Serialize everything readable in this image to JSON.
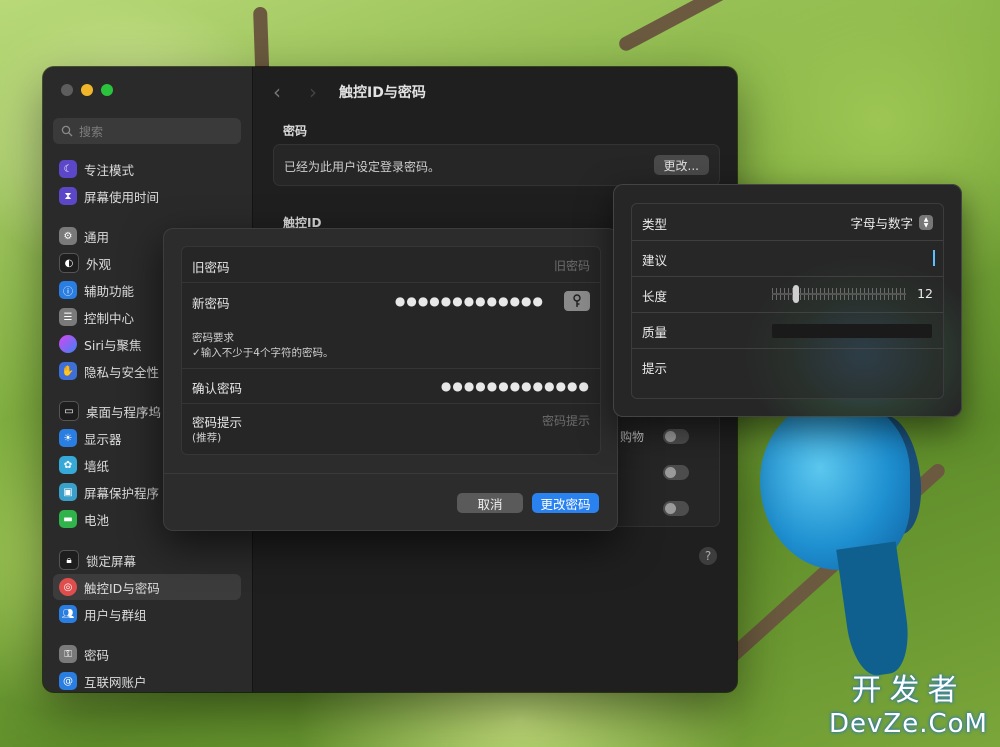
{
  "window": {
    "title": "触控ID与密码",
    "search_placeholder": "搜索"
  },
  "sidebar": {
    "items": [
      {
        "label": "专注模式",
        "icon": "moon-icon",
        "color": "#5d47c9"
      },
      {
        "label": "屏幕使用时间",
        "icon": "hourglass-icon",
        "color": "#5d47c9"
      },
      {
        "label": "通用",
        "icon": "gear-icon",
        "color": "#7a7a7a"
      },
      {
        "label": "外观",
        "icon": "appearance-icon",
        "color": "#1e1e1e"
      },
      {
        "label": "辅助功能",
        "icon": "accessibility-icon",
        "color": "#2a7de1"
      },
      {
        "label": "控制中心",
        "icon": "control-center-icon",
        "color": "#7a7a7a"
      },
      {
        "label": "Siri与聚焦",
        "icon": "siri-icon",
        "color": "#8a3fd8"
      },
      {
        "label": "隐私与安全性",
        "icon": "hand-icon",
        "color": "#3d6fd6"
      },
      {
        "label": "桌面与程序坞",
        "icon": "dock-icon",
        "color": "#1e1e1e"
      },
      {
        "label": "显示器",
        "icon": "sun-icon",
        "color": "#2a7de1"
      },
      {
        "label": "墙纸",
        "icon": "flower-icon",
        "color": "#36a9d9"
      },
      {
        "label": "屏幕保护程序",
        "icon": "screensaver-icon",
        "color": "#3aa0c9"
      },
      {
        "label": "电池",
        "icon": "battery-icon",
        "color": "#2fb34a"
      },
      {
        "label": "锁定屏幕",
        "icon": "lock-icon",
        "color": "#1e1e1e"
      },
      {
        "label": "触控ID与密码",
        "icon": "fingerprint-icon",
        "color": "#e04d4d"
      },
      {
        "label": "用户与群组",
        "icon": "users-icon",
        "color": "#2a7de1"
      },
      {
        "label": "密码",
        "icon": "key-icon",
        "color": "#7a7a7a"
      },
      {
        "label": "互联网账户",
        "icon": "at-icon",
        "color": "#2a7de1"
      }
    ]
  },
  "main": {
    "password_section": "密码",
    "password_text": "已经为此用户设定登录密码。",
    "change_button": "更改...",
    "touchid_section": "触控ID",
    "partial_row_text": "购物"
  },
  "dialog": {
    "old_password_label": "旧密码",
    "old_password_placeholder": "旧密码",
    "new_password_label": "新密码",
    "new_password_value": "●●●●●●●●●●●●●",
    "requirement_title": "密码要求",
    "requirement_text": "✓输入不少于4个字符的密码。",
    "confirm_label": "确认密码",
    "confirm_value": "●●●●●●●●●●●●●",
    "hint_label": "密码提示",
    "hint_sub": "(推荐)",
    "hint_placeholder": "密码提示",
    "cancel_button": "取消",
    "change_button": "更改密码"
  },
  "assistant": {
    "type_label": "类型",
    "type_value": "字母与数字",
    "suggestion_label": "建议",
    "length_label": "长度",
    "length_value": "12",
    "length_fraction": 0.18,
    "quality_label": "质量",
    "hint_label": "提示"
  },
  "watermark": {
    "line1": "开发者",
    "line2": "DevZe.CoM"
  }
}
